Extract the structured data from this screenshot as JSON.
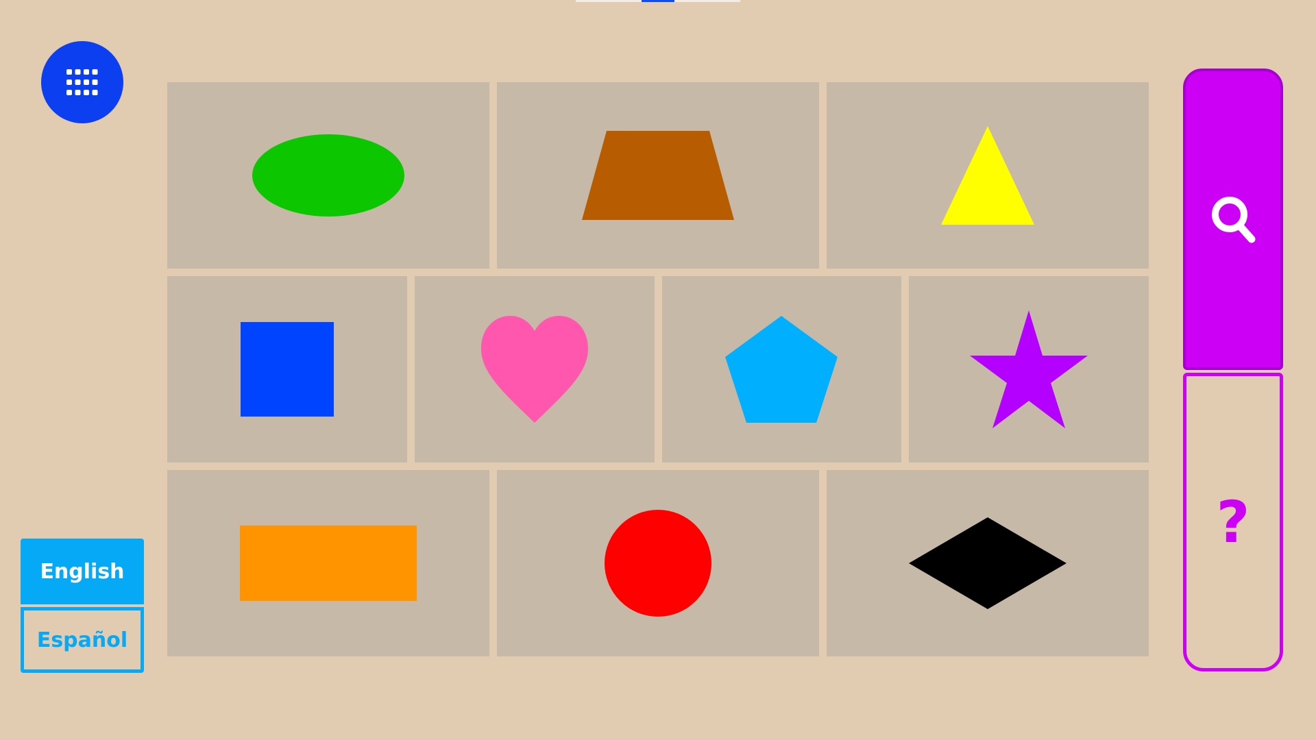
{
  "menu": {
    "icon": "grid-menu-icon"
  },
  "languages": {
    "active_label": "English",
    "inactive_label": "Español"
  },
  "side": {
    "search_icon": "magnifier-icon",
    "help_label": "?"
  },
  "shapes": [
    {
      "name": "oval",
      "color": "#0cc700"
    },
    {
      "name": "trapezoid",
      "color": "#b85c00"
    },
    {
      "name": "triangle",
      "color": "#ffff00"
    },
    {
      "name": "square",
      "color": "#0044ff"
    },
    {
      "name": "heart",
      "color": "#ff57ad"
    },
    {
      "name": "pentagon",
      "color": "#00b0ff"
    },
    {
      "name": "star",
      "color": "#b300ff"
    },
    {
      "name": "rectangle",
      "color": "#ff9400"
    },
    {
      "name": "circle",
      "color": "#ff0000"
    },
    {
      "name": "diamond",
      "color": "#000000"
    }
  ],
  "colors": {
    "background": "#e1cbb1",
    "tile": "#c7b9a7",
    "menu": "#0b3ff0",
    "language": "#05a9f5",
    "side": "#cc00f5"
  }
}
